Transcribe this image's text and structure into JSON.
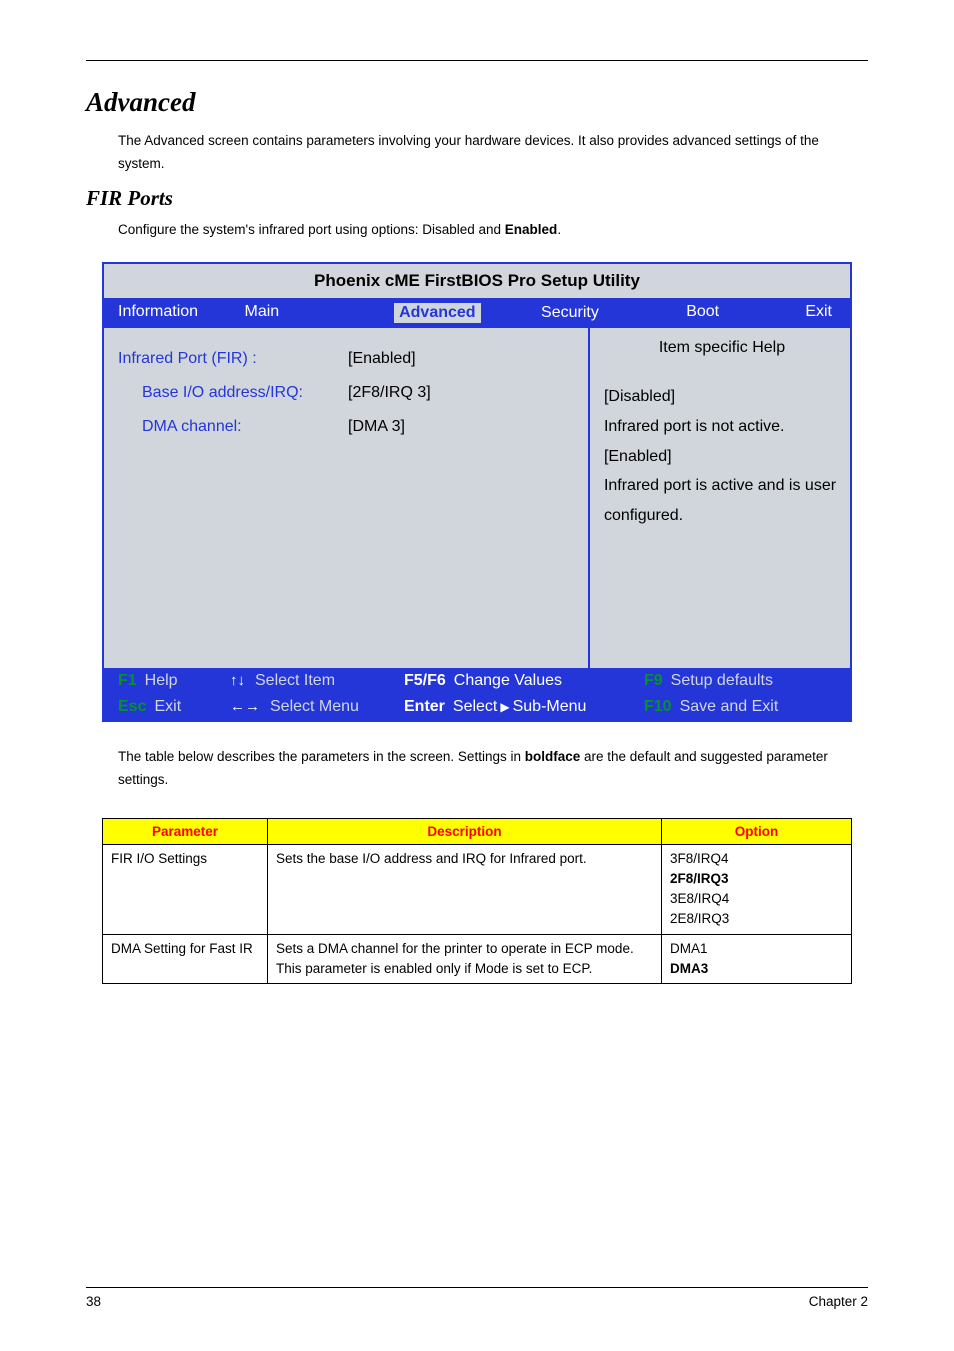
{
  "section_title": "Advanced",
  "intro_text_before": "The Advanced screen contains parameters involving your hardware devices. It also provides advanced settings of the system.",
  "subsection_title": "FIR Ports",
  "subsection_text_prefix": "Configure the system's infrared port using options: Disabled and ",
  "subsection_text_bold": "Enabled",
  "subsection_text_suffix": ".",
  "bios": {
    "title": "Phoenix cME FirstBIOS Pro Setup Utility",
    "tabs": {
      "info": "Information",
      "main": "Main",
      "advanced": "Advanced",
      "security": "Security",
      "boot": "Boot",
      "exit": "Exit"
    },
    "rows": [
      {
        "label": "Infrared Port (FIR) :",
        "value": "[Enabled]",
        "indent": false
      },
      {
        "label": "Base I/O address/IRQ:",
        "value": "[2F8/IRQ 3]",
        "indent": true
      },
      {
        "label": "DMA channel:",
        "value": "[DMA 3]",
        "indent": true
      }
    ],
    "help_header": "Item specific Help",
    "help_body": "[Disabled]\nInfrared port is not active.\n[Enabled]\nInfrared port is active and is user configured.",
    "footer": {
      "f1": "F1",
      "help": "Help",
      "select_item": "Select Item",
      "f5f6": "F5/F6",
      "change_values": "Change Values",
      "f9": "F9",
      "setup_defaults": "Setup defaults",
      "esc": "Esc",
      "exit": "Exit",
      "select_menu": "Select Menu",
      "enter": "Enter",
      "select_sub": "Select",
      "sub_menu": "Sub-Menu",
      "f10": "F10",
      "save_exit": "Save and Exit"
    }
  },
  "table_intro_prefix": "The table below describes the parameters in the screen. Settings in ",
  "table_intro_bold": "boldface",
  "table_intro_suffix": " are the default and suggested parameter settings.",
  "param_table": {
    "headers": {
      "param": "Parameter",
      "desc": "Description",
      "opt": "Option"
    },
    "rows": [
      {
        "param": "FIR I/O Settings",
        "desc": "Sets the base I/O address and IRQ for Infrared port.",
        "opts": [
          "3F8/IRQ4",
          "2F8/IRQ3",
          "3E8/IRQ4",
          "2E8/IRQ3"
        ],
        "bold_opt_index": 1
      },
      {
        "param": "DMA Setting for Fast IR",
        "desc": "Sets a DMA channel for the printer to operate in ECP mode. This parameter is enabled only if Mode is set to ECP.",
        "opts": [
          "DMA1",
          "DMA3"
        ],
        "bold_opt_index": 1
      }
    ]
  },
  "footer": {
    "page": "38",
    "chapter": "Chapter 2"
  }
}
